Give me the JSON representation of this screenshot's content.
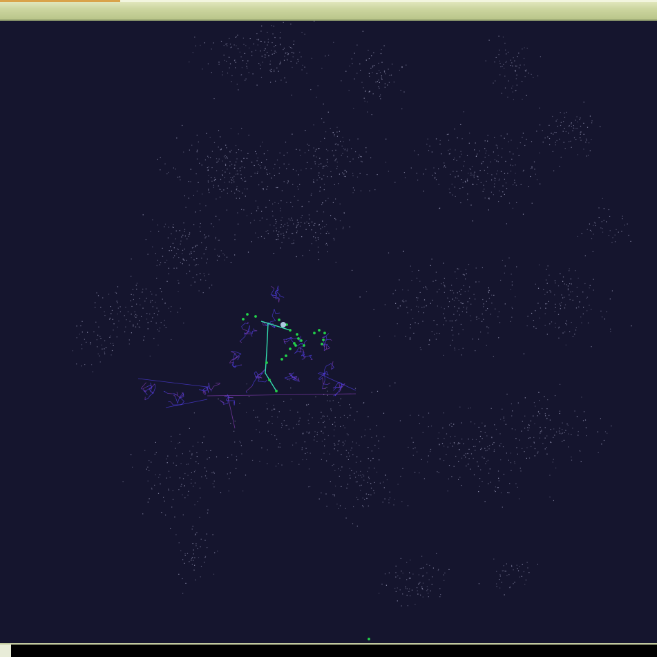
{
  "window": {
    "title": "",
    "titlebar_color": "#cdd6a0",
    "tab_accent_color": "#d9a34a"
  },
  "scene": {
    "type": "network-visualization",
    "background_color": "#15152e",
    "star_color": "#a8a8c8",
    "edge_color": "#4b3bd6",
    "edge_color_alt": "#7a3aa8",
    "highlight_path_color": "#34e0b0",
    "node_color": "#22d24a",
    "focus_node_color": "#c8e8ff"
  },
  "status_bar": {
    "text": "",
    "background_color": "#000000"
  }
}
